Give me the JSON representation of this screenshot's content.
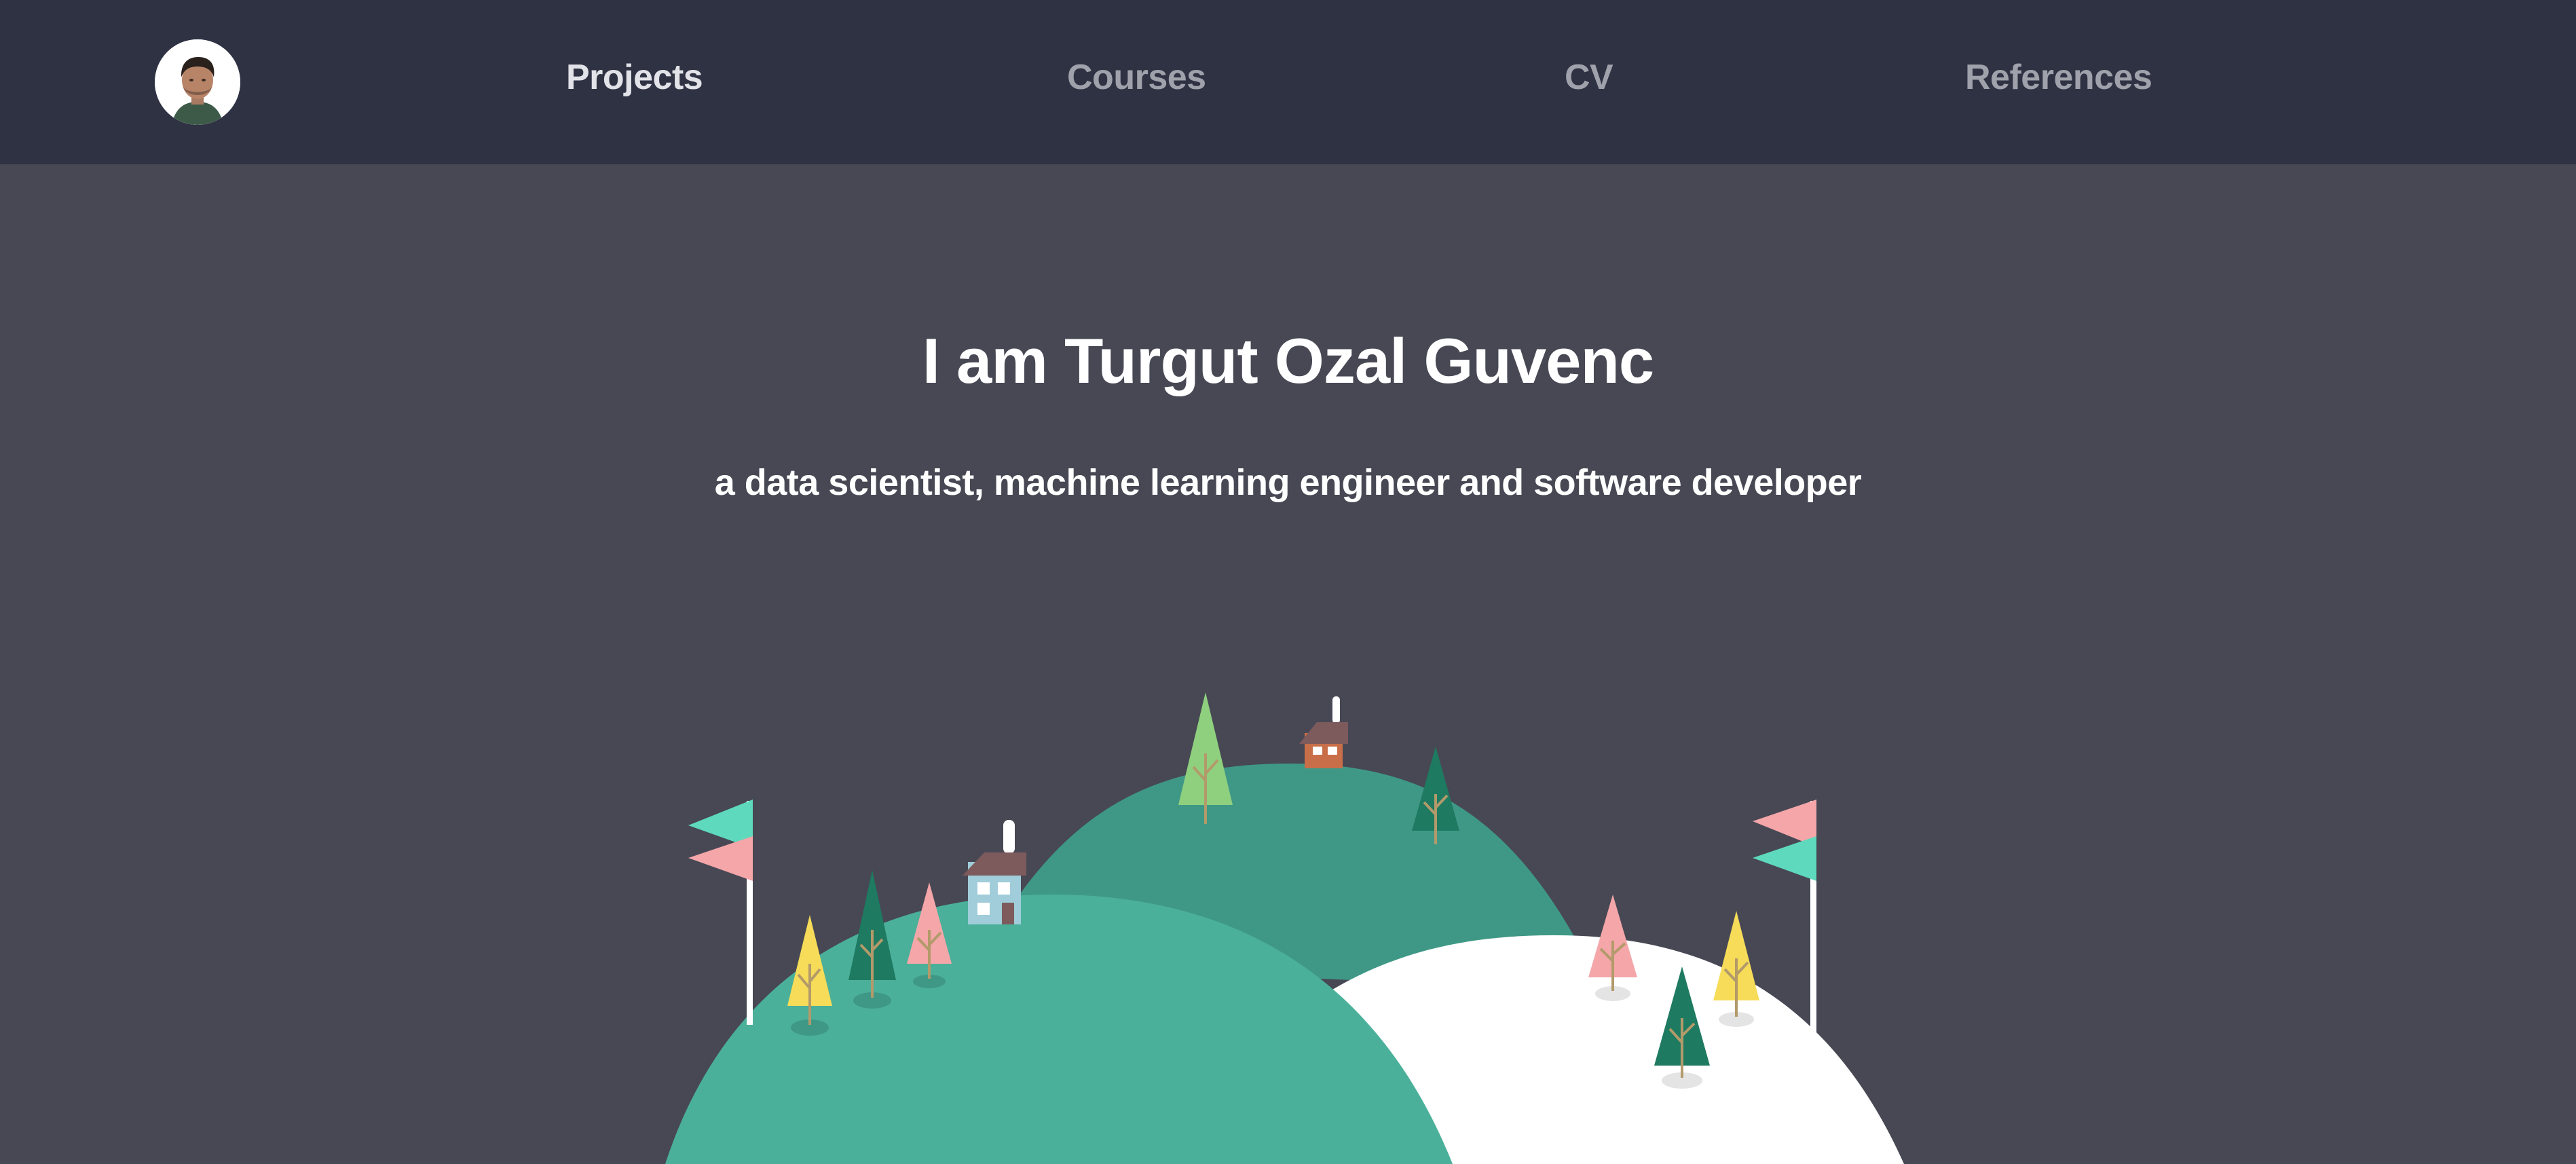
{
  "nav": {
    "avatar_alt": "profile photo",
    "links": [
      {
        "label": "Projects",
        "active": true
      },
      {
        "label": "Courses",
        "active": false
      },
      {
        "label": "CV",
        "active": false
      },
      {
        "label": "References",
        "active": false
      }
    ]
  },
  "hero": {
    "title": "I am Turgut Ozal Guvenc",
    "subtitle": "a data scientist, machine learning engineer and software developer"
  },
  "colors": {
    "navbar_bg": "#2f3243",
    "page_bg": "#474854",
    "hill_front": "#4bb09a",
    "hill_back": "#3f9886",
    "hill_snow": "#ffffff",
    "tree_dark": "#1e7a61",
    "tree_light": "#8fd07f",
    "tree_pink": "#f4a6a9",
    "tree_yellow": "#f6dc58",
    "flag_teal": "#5fd9bd",
    "flag_pink": "#f4a6a9"
  }
}
